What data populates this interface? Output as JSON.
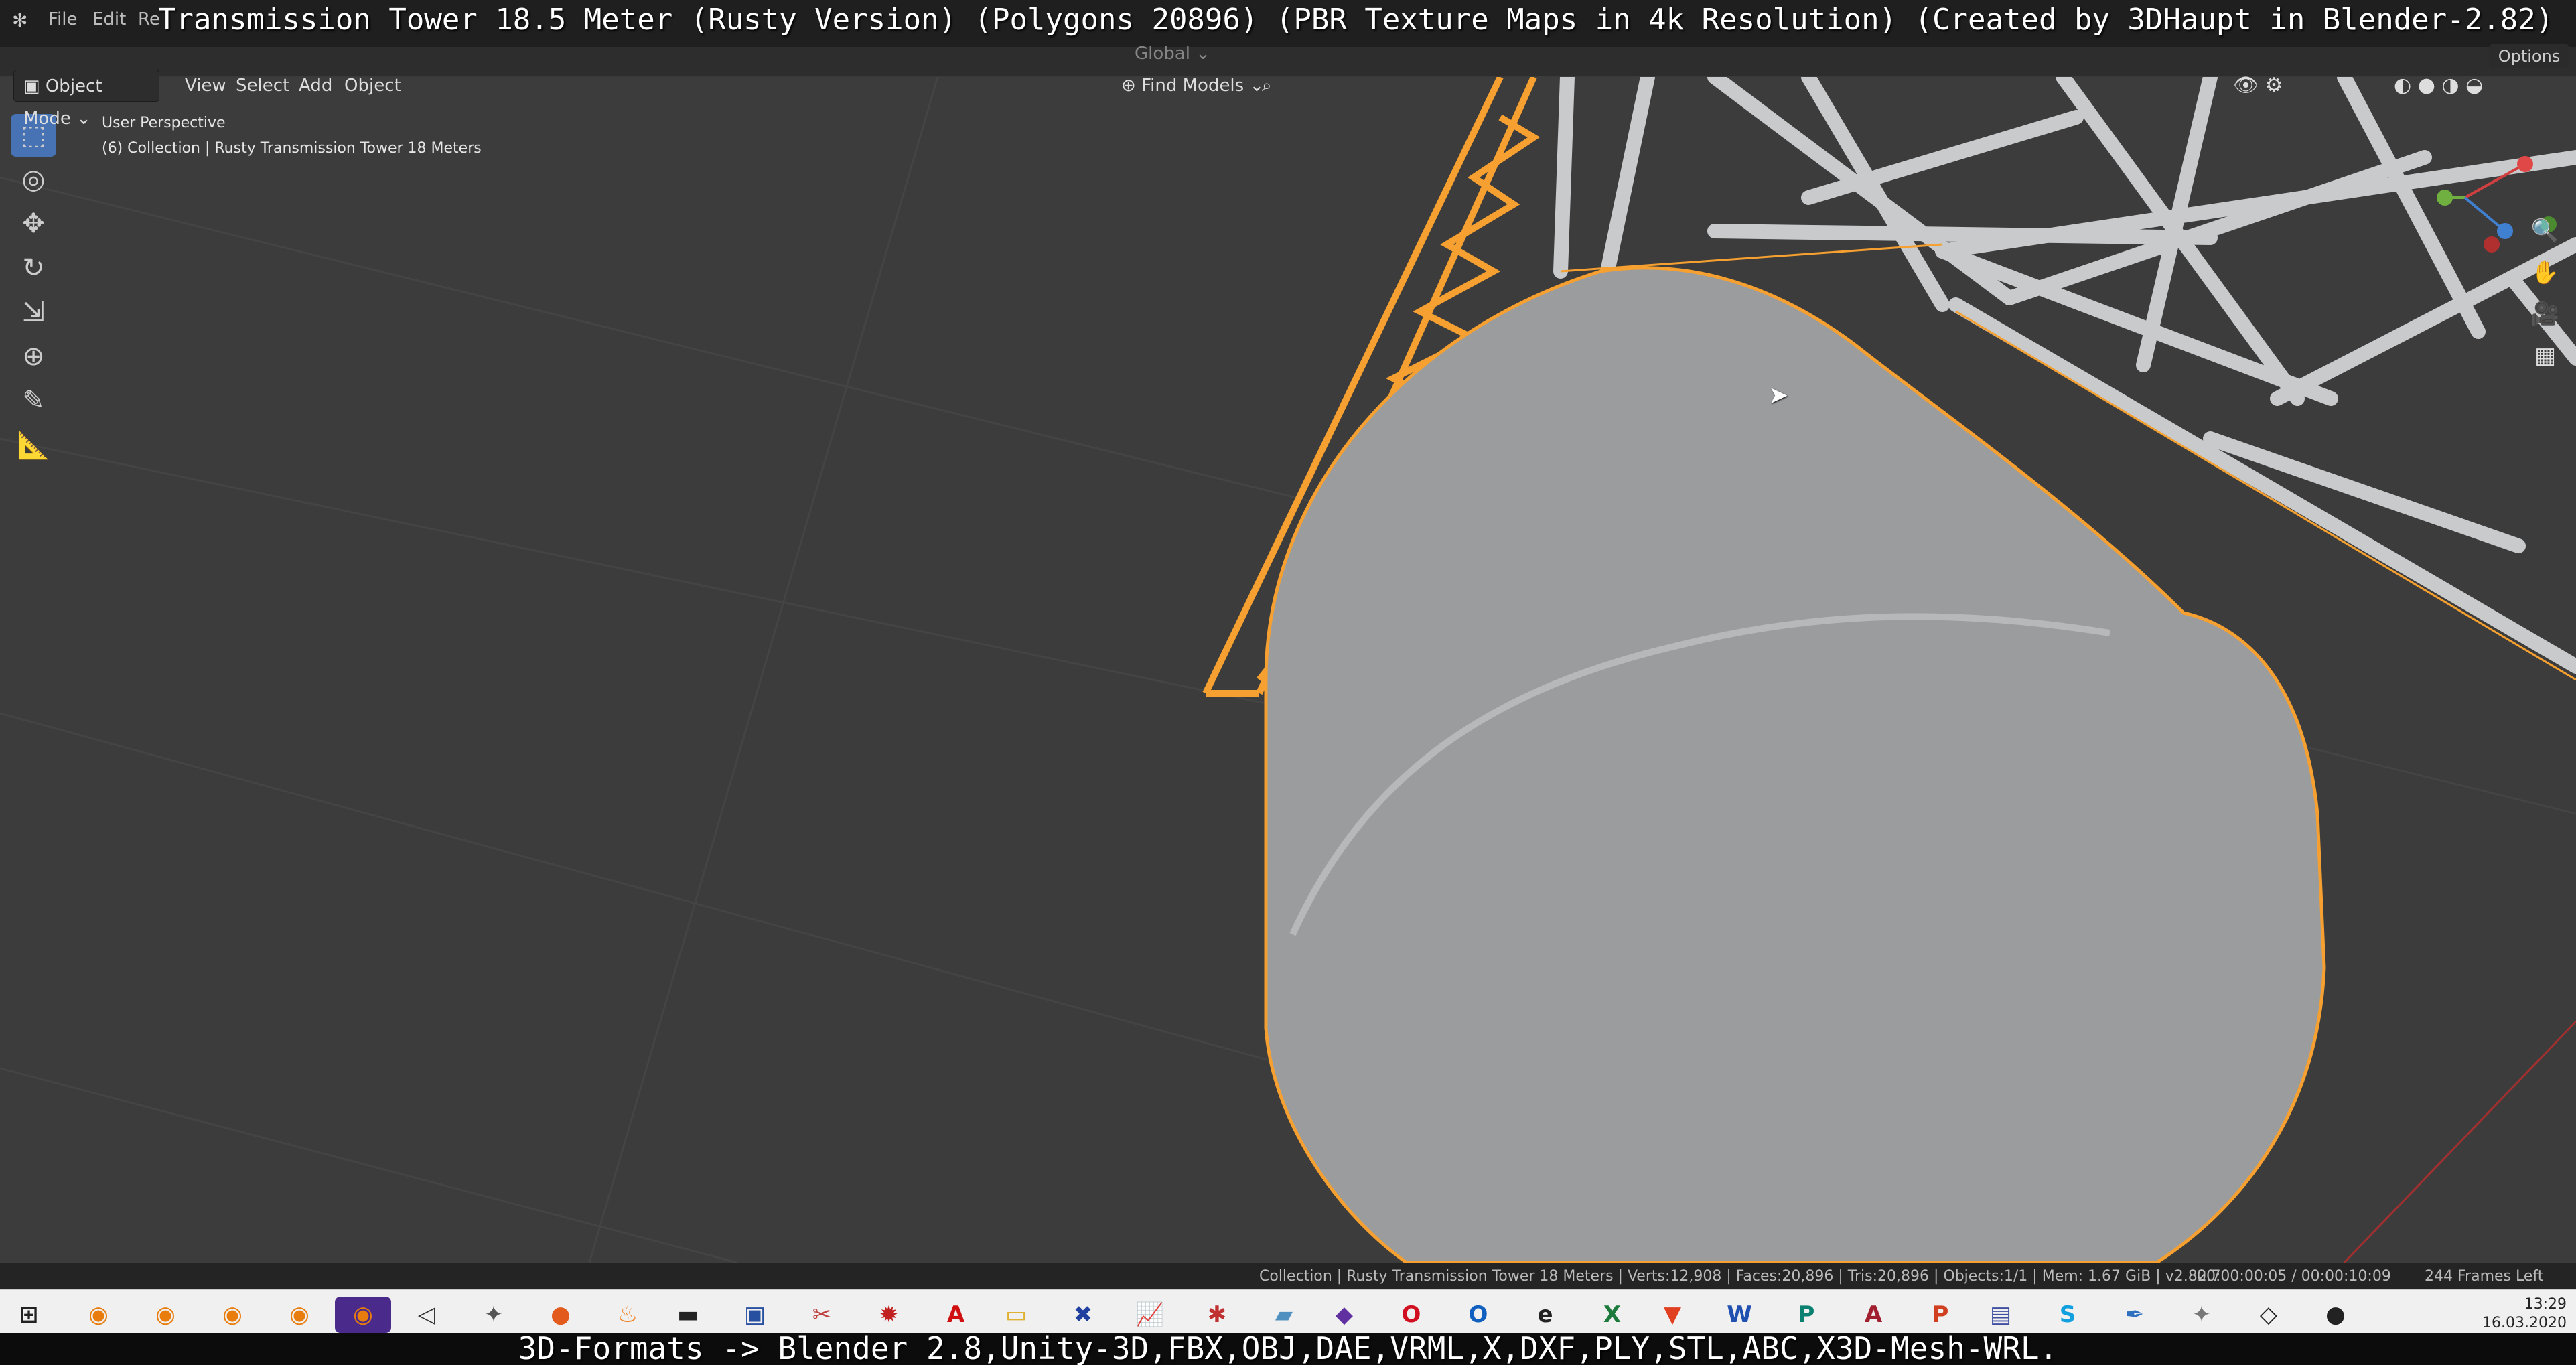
{
  "window": {
    "title_overlay": "Transmission Tower 18.5 Meter (Rusty Version) (Polygons 20896) (PBR Texture Maps in 4k Resolution) (Created by 3DHaupt in Blender-2.82)",
    "menu": {
      "file": "File",
      "edit": "Edit",
      "render": "Re"
    },
    "options_label": "Options"
  },
  "header": {
    "mode": "Object Mode",
    "view": "View",
    "select": "Select",
    "add": "Add",
    "object": "Object",
    "transform_orientation": "Global",
    "find_models": "Find Models"
  },
  "viewport": {
    "perspective": "User Perspective",
    "collection": "(6) Collection | Rusty Transmission Tower 18 Meters"
  },
  "statusbar": {
    "stats": "Collection | Rusty Transmission Tower 18 Meters | Verts:12,908 | Faces:20,896 | Tris:20,896 | Objects:1/1 | Mem: 1.67 GiB | v2.82.7",
    "time": "00:00:00:05 / 00:00:10:09",
    "frames": "244 Frames Left"
  },
  "taskbar": {
    "time": "13:29",
    "date": "16.03.2020"
  },
  "caption": "3D-Formats -> Blender 2.8,Unity-3D,FBX,OBJ,DAE,VRML,X,DXF,PLY,STL,ABC,X3D-Mesh-WRL.",
  "colors": {
    "selection_outline": "#f5a030",
    "active_tool": "#4772b3",
    "viewport_bg": "#3c3c3c",
    "mesh_gray": "#9a9c9e"
  }
}
